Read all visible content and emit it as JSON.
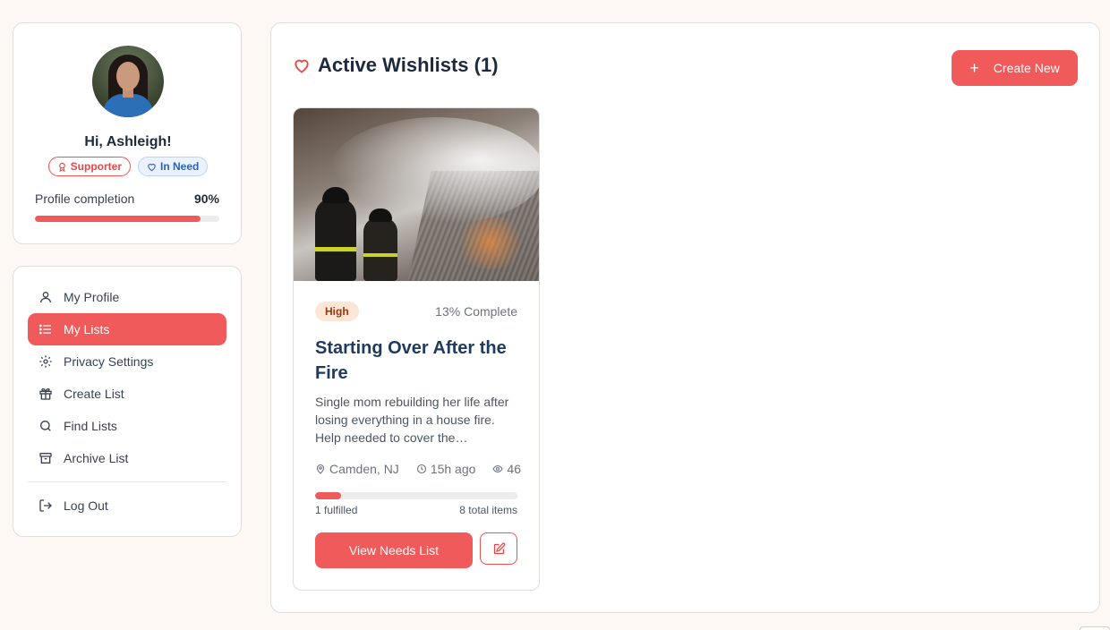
{
  "profile": {
    "greeting": "Hi, Ashleigh!",
    "badges": {
      "supporter": "Supporter",
      "in_need": "In Need"
    },
    "completion_label": "Profile completion",
    "completion_value": "90%",
    "completion_fraction": 0.9
  },
  "nav": {
    "items": [
      {
        "label": "My Profile",
        "icon": "user-icon",
        "active": false
      },
      {
        "label": "My Lists",
        "icon": "list-icon",
        "active": true
      },
      {
        "label": "Privacy Settings",
        "icon": "gear-icon",
        "active": false
      },
      {
        "label": "Create List",
        "icon": "gift-icon",
        "active": false
      },
      {
        "label": "Find Lists",
        "icon": "search-icon",
        "active": false
      },
      {
        "label": "Archive List",
        "icon": "archive-icon",
        "active": false
      }
    ],
    "logout": "Log Out"
  },
  "main": {
    "title": "Active Wishlists (1)",
    "create_label": "Create New"
  },
  "wishlist": {
    "priority": "High",
    "complete": "13% Complete",
    "progress_fraction": 0.13,
    "title": "Starting Over After the Fire",
    "description": "Single mom rebuilding her life after losing everything in a house fire. Help needed to cover the…",
    "location": "Camden, NJ",
    "time": "15h ago",
    "views": "46",
    "fulfilled": "1 fulfilled",
    "total": "8 total items",
    "view_label": "View Needs List"
  },
  "colors": {
    "accent": "#f05a5a",
    "background": "#fdf8f4",
    "priority_bg": "#fde7d4",
    "priority_text": "#9a3412",
    "in_need_bg": "#eaf2fd",
    "in_need_text": "#2b63b8"
  }
}
